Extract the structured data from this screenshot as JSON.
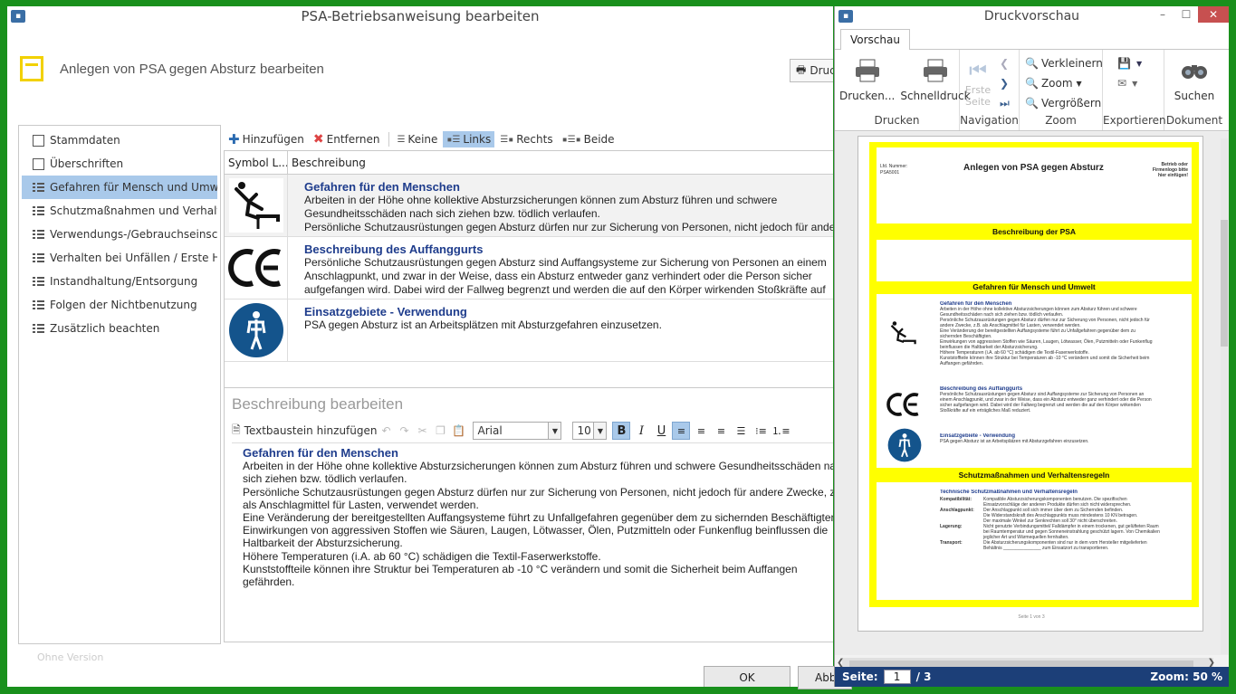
{
  "main_window": {
    "title": "PSA-Betriebsanweisung bearbeiten",
    "header_title": "Anlegen von PSA gegen Absturz bearbeiten",
    "druck_label": "Druc",
    "ok_label": "OK",
    "cancel_label": "Abb"
  },
  "nav": {
    "items": [
      {
        "label": "Stammdaten",
        "icon": "box-icon"
      },
      {
        "label": "Überschriften",
        "icon": "box-icon"
      },
      {
        "label": "Gefahren für Mensch und Umwelt",
        "icon": "list-icon"
      },
      {
        "label": "Schutzmaßnahmen und Verhalte...",
        "icon": "list-icon"
      },
      {
        "label": "Verwendungs-/Gebrauchseinsch...",
        "icon": "list-icon"
      },
      {
        "label": "Verhalten bei Unfällen / Erste Hilfe",
        "icon": "list-icon"
      },
      {
        "label": "Instandhaltung/Entsorgung",
        "icon": "list-icon"
      },
      {
        "label": "Folgen der Nichtbenutzung",
        "icon": "list-icon"
      },
      {
        "label": "Zusätzlich beachten",
        "icon": "list-icon"
      }
    ],
    "selected_index": 2,
    "footer": "Ohne Version"
  },
  "toolbar": {
    "add": "Hinzufügen",
    "remove": "Entfernen",
    "none": "Keine",
    "left": "Links",
    "right": "Rechts",
    "both": "Beide"
  },
  "grid": {
    "col_symbol": "Symbol L...",
    "col_desc": "Beschreibung",
    "rows": [
      {
        "title": "Gefahren für den Menschen",
        "lines": [
          "Arbeiten in der Höhe ohne kollektive Absturzsicherungen können zum Absturz führen und schwere",
          "Gesundheitsschäden nach sich ziehen bzw. tödlich verlaufen.",
          "Persönliche Schutzausrüstungen gegen Absturz dürfen nur zur Sicherung von Personen, nicht jedoch für andere Zwecke,"
        ],
        "symbol": "fall-hazard-icon"
      },
      {
        "title": "Beschreibung des Auffanggurts",
        "lines": [
          "Persönliche Schutzausrüstungen gegen Absturz sind Auffangsysteme zur Sicherung von Personen an einem",
          "Anschlagpunkt, und zwar in der Weise, dass ein Absturz entweder ganz verhindert oder die Person sicher",
          "aufgefangen wird. Dabei wird der Fallweg begrenzt und werden die auf den Körper wirkenden Stoßkräfte auf"
        ],
        "symbol": "ce-mark-icon"
      },
      {
        "title": "Einsatzgebiete - Verwendung",
        "lines": [
          "PSA gegen Absturz ist an Arbeitsplätzen mit Absturzgefahren einzusetzen."
        ],
        "symbol": "harness-icon"
      }
    ]
  },
  "editor": {
    "title": "Beschreibung bearbeiten",
    "textbaustein": "Textbaustein hinzufügen",
    "font": "Arial",
    "size": "10",
    "body_title": "Gefahren für den Menschen",
    "body_lines": [
      "Arbeiten in der Höhe ohne kollektive Absturzsicherungen können zum Absturz führen und schwere Gesundheitsschäden nach",
      "sich ziehen bzw. tödlich verlaufen.",
      "Persönliche Schutzausrüstungen gegen Absturz dürfen nur zur Sicherung von Personen, nicht jedoch für andere Zwecke, z.B.",
      "als Anschlagmittel für Lasten, verwendet werden.",
      "Eine Veränderung der bereitgestellten Auffangsysteme führt zu Unfallgefahren gegenüber dem zu sichernden Beschäftigten.",
      "Einwirkungen von aggressiven Stoffen wie Säuren, Laugen, Lötwasser, Ölen, Putzmitteln oder Funkenflug beinflussen die",
      "Haltbarkeit der Absturzsicherung.",
      "Höhere Temperaturen (i.A. ab 60 °C) schädigen die Textil-Faserwerkstoffe.",
      "Kunststoffteile können ihre Struktur bei Temperaturen  ab -10 °C verändern und somit die Sicherheit beim Auffangen",
      "gefährden."
    ]
  },
  "preview": {
    "title": "Druckvorschau",
    "tab": "Vorschau",
    "groups": {
      "drucken": {
        "label": "Drucken",
        "print": "Drucken...",
        "quick": "Schnelldruck"
      },
      "navigation": {
        "label": "Navigation",
        "first": "Erste",
        "first2": "Seite"
      },
      "zoom": {
        "label": "Zoom",
        "out": "Verkleinern",
        "zoom": "Zoom",
        "in": "Vergrößern"
      },
      "export": {
        "label": "Exportieren"
      },
      "doc": {
        "label": "Dokument",
        "search": "Suchen"
      }
    },
    "page": {
      "lfd_label": "Lfd. Nummer:",
      "lfd_value": "PSA5001",
      "heading": "Anlegen von PSA gegen Absturz",
      "logo_note": [
        "Betrieb oder",
        "Firmenlogo bitte",
        "hier einfügen!"
      ],
      "sec1": "Beschreibung der PSA",
      "sec2": "Gefahren für Mensch und Umwelt",
      "sec3": "Schutzmaßnahmen und Verhaltensregeln",
      "g1_title": "Gefahren für den Menschen",
      "g1_lines": [
        "Arbeiten in der Höhe ohne kollektive Absturzsicherungen können zum Absturz führen und schwere",
        "Gesundheitsschäden nach sich ziehen bzw. tödlich verlaufen.",
        "Persönliche Schutzausrüstungen gegen Absturz dürfen nur zur Sicherung von Personen, nicht jedoch für",
        "andere Zwecke, z.B. als Anschlagmittel für Lasten, verwendet werden.",
        "Eine Veränderung der bereitgestellten Auffangsysteme führt zu Unfallgefahren gegenüber dem zu",
        "sichernden Beschäftigten.",
        "Einwirkungen von aggressiven Stoffen wie Säuren, Laugen, Lötwasser, Ölen, Putzmitteln oder Funkenflug",
        "beinflussen die Haltbarkeit der Absturzsicherung.",
        "Höhere Temperaturen (i.A. ab 60 °C) schädigen die Textil-Faserwerkstoffe.",
        "Kunststoffteile können ihre Struktur bei Temperaturen  ab -10 °C verändern und somit die Sicherheit beim",
        "Auffangen gefährden."
      ],
      "g2_title": "Beschreibung des Auffanggurts",
      "g2_lines": [
        "Persönliche Schutzausrüstungen gegen Absturz sind Auffangsysteme zur Sicherung von Personen an",
        "einem Anschlagpunkt, und zwar in der Weise, dass ein Absturz entweder ganz verhindert oder die Person",
        "sicher aufgefangen wird. Dabei wird der Fallweg begrenzt und werden die auf den Körper wirkenden",
        "Stoßkräfte auf ein erträgliches Maß reduziert."
      ],
      "g3_title": "Einsatzgebiete - Verwendung",
      "g3_lines": [
        "PSA gegen Absturz ist an Arbeitsplätzen mit Absturzgefahren einzusetzen."
      ],
      "s_title": "Technische  Schutzmaßnahmen  und  Verhaltensregeln",
      "s_rows": [
        {
          "k": "Kompatibilität:",
          "v": "Kompatible Absturzsicherungskomponenten benutzen. Die spezifischen"
        },
        {
          "k": "",
          "v": "Einsatzvorschläge der anderen Produkte dürfen sich nicht widersprechen."
        },
        {
          "k": "Anschlagpunkt:",
          "v": "Der Anschlagpunkt soll sich immer über dem zu Sichernden befinden."
        },
        {
          "k": "",
          "v": "Die Widerstandskraft des Anschlagpunkts muss mindestens 10 KN betragen."
        },
        {
          "k": "",
          "v": "Der maximale Winkel zur Senkrechten soll 30° nicht überschreiten."
        },
        {
          "k": "Lagerung:",
          "v": "Nicht genutzte Verbindungsmittel/ Falldämpfer in einem trockenen, gut gelüfteten Raum"
        },
        {
          "k": "",
          "v": "bei Raumtemperatur und gegen Sonneneinstrahlung geschützt lagern. Von Chemikalien"
        },
        {
          "k": "",
          "v": "jeglicher Art und Wärmequellen fernhalten."
        },
        {
          "k": "Transport:",
          "v": "Die Absturzsicherungskomponenten sind nur in dem vom Hersteller mitgelieferten"
        },
        {
          "k": "",
          "v": "Behältnis _______________ zum Einsatzort zu transportieren."
        }
      ],
      "footer": "Seite 1 von 3"
    },
    "status": {
      "page_label": "Seite:",
      "page_value": "1",
      "page_total": "/ 3",
      "zoom": "Zoom: 50 %"
    }
  }
}
